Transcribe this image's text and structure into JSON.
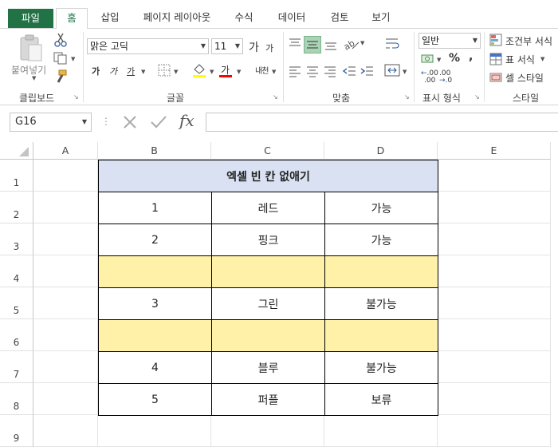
{
  "tabs": [
    "파일",
    "홈",
    "삽입",
    "페이지 레이아웃",
    "수식",
    "데이터",
    "검토",
    "보기"
  ],
  "ribbon": {
    "clipboard": {
      "paste_label": "붙여넣기",
      "group_label": "클립보드"
    },
    "font": {
      "name": "맑은 고딕",
      "size": "11",
      "grow": "가",
      "shrink": "가",
      "bold": "가",
      "italic": "가",
      "underline": "가",
      "color_a": "가",
      "phonetic": "내천",
      "group_label": "글꼴"
    },
    "alignment": {
      "group_label": "맞춤"
    },
    "number": {
      "format": "일반",
      "percent": "%",
      "comma": ",",
      "dec_inc": ".00",
      "dec_dec": ".00",
      "group_label": "표시 형식"
    },
    "styles": {
      "conditional": "조건부 서식",
      "table": "표 서식",
      "cell": "셀 스타일",
      "group_label": "스타일"
    }
  },
  "formula_bar": {
    "name_box": "G16",
    "fx": "fx",
    "value": ""
  },
  "columns": [
    "A",
    "B",
    "C",
    "D",
    "E"
  ],
  "rows": [
    "1",
    "2",
    "3",
    "4",
    "5",
    "6",
    "7",
    "8",
    "9"
  ],
  "table": {
    "title": "엑셀 빈 칸 없애기",
    "rows": [
      {
        "b": "1",
        "c": "레드",
        "d": "가능",
        "highlight": false
      },
      {
        "b": "2",
        "c": "핑크",
        "d": "가능",
        "highlight": false
      },
      {
        "b": "",
        "c": "",
        "d": "",
        "highlight": true
      },
      {
        "b": "3",
        "c": "그린",
        "d": "불가능",
        "highlight": false
      },
      {
        "b": "",
        "c": "",
        "d": "",
        "highlight": true
      },
      {
        "b": "4",
        "c": "블루",
        "d": "불가능",
        "highlight": false
      },
      {
        "b": "5",
        "c": "퍼플",
        "d": "보류",
        "highlight": false
      }
    ]
  },
  "colors": {
    "excel_green": "#217346",
    "title_fill": "#d9e1f2",
    "yellow_fill": "#fff2a8",
    "font_red": "#ff0000"
  }
}
